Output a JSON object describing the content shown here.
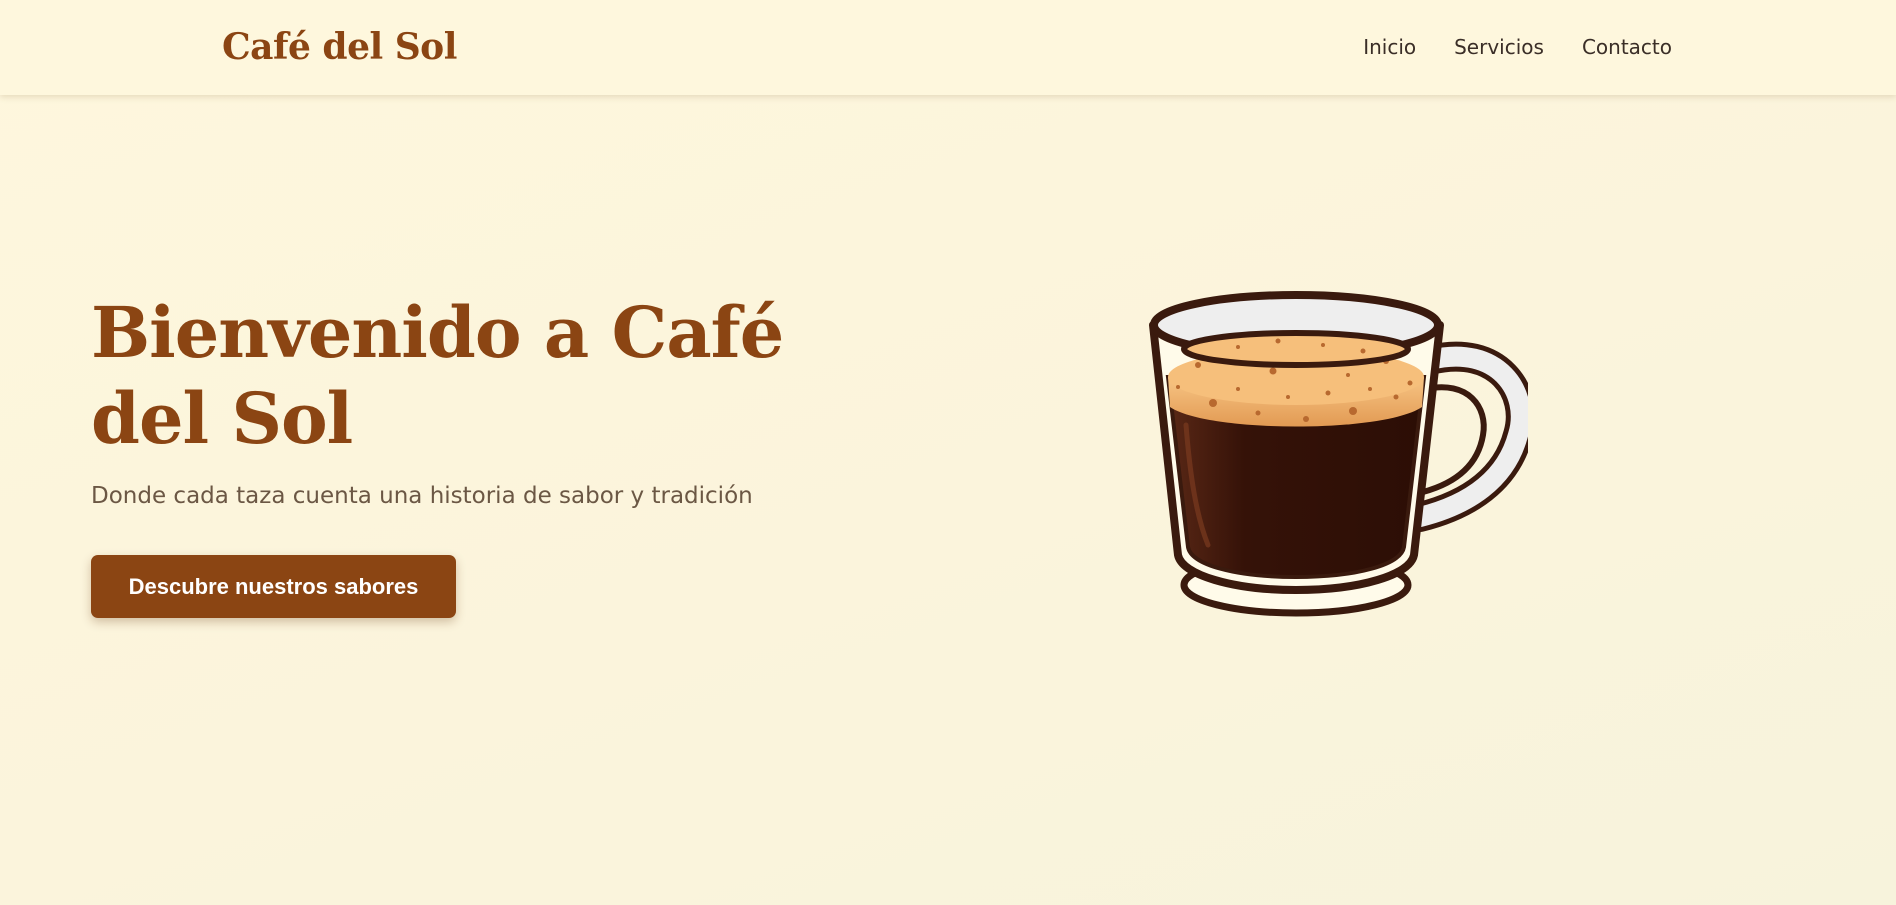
{
  "header": {
    "brand": "Café del Sol",
    "nav": [
      {
        "label": "Inicio"
      },
      {
        "label": "Servicios"
      },
      {
        "label": "Contacto"
      }
    ]
  },
  "hero": {
    "title": "Bienvenido a Café del Sol",
    "subtitle": "Donde cada taza cuenta una historia de sabor y tradición",
    "cta_label": "Descubre nuestros sabores",
    "illustration": "coffee-mug-icon"
  },
  "colors": {
    "brand": "#8b4513",
    "background": "#fef7dd",
    "text": "#3a2e27",
    "subtitle": "#6b5744",
    "coffee": "#351208",
    "crema": "#e9a35c",
    "outline": "#3a1a0e"
  }
}
